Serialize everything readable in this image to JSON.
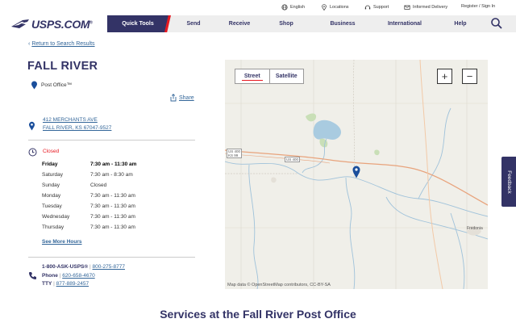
{
  "utility": {
    "english": "English",
    "locations": "Locations",
    "support": "Support",
    "informed_delivery": "Informed Delivery",
    "register": "Register / Sign In"
  },
  "logo": {
    "text": "USPS.COM",
    "mark": "®"
  },
  "nav": {
    "quick_tools": "Quick Tools",
    "send": "Send",
    "receive": "Receive",
    "shop": "Shop",
    "business": "Business",
    "international": "International",
    "help": "Help"
  },
  "back_link": "Return to Search Results",
  "title": "FALL RIVER",
  "location_type": "Post Office™",
  "share": "Share",
  "address": {
    "line1": "412 MERCHANTS AVE",
    "line2": "FALL RIVER, KS 67047-9527"
  },
  "status": "Closed",
  "hours": [
    {
      "day": "Friday",
      "time": "7:30 am - 11:30 am",
      "today": true
    },
    {
      "day": "Saturday",
      "time": "7:30 am - 8:30 am",
      "today": false
    },
    {
      "day": "Sunday",
      "time": "Closed",
      "today": false
    },
    {
      "day": "Monday",
      "time": "7:30 am - 11:30 am",
      "today": false
    },
    {
      "day": "Tuesday",
      "time": "7:30 am - 11:30 am",
      "today": false
    },
    {
      "day": "Wednesday",
      "time": "7:30 am - 11:30 am",
      "today": false
    },
    {
      "day": "Thursday",
      "time": "7:30 am - 11:30 am",
      "today": false
    }
  ],
  "see_more_hours": "See More Hours",
  "contact": {
    "ask_label": "1-800-ASK-USPS®",
    "ask_number": "800-275-8777",
    "phone_label": "Phone",
    "phone_number": "620-658-4670",
    "tty_label": "TTY",
    "tty_number": "877-889-2457",
    "separator": "|"
  },
  "map": {
    "street": "Street",
    "satellite": "Satellite",
    "zoom_in": "+",
    "zoom_out": "−",
    "attribution": "Map data © OpenStreetMap contributors, CC-BY-SA",
    "route_us400": "US 400",
    "route_us400_99": "US 400\nKS 99",
    "town_fredonia": "Fredonia"
  },
  "feedback": "Feedback",
  "services_heading": "Services at the Fall River Post Office",
  "colors": {
    "navy": "#333366",
    "red": "#e71921",
    "link": "#336699"
  }
}
